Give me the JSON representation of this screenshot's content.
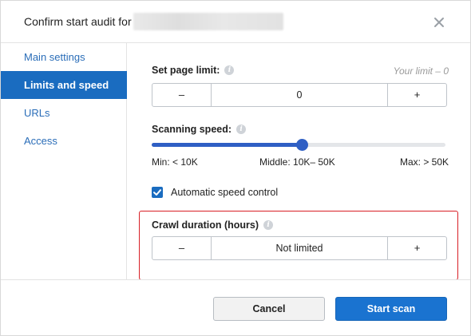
{
  "dialog": {
    "title": "Confirm start audit for",
    "close_icon": "close-icon"
  },
  "sidebar": {
    "items": [
      {
        "label": "Main settings",
        "active": false
      },
      {
        "label": "Limits and speed",
        "active": true
      },
      {
        "label": "URLs",
        "active": false
      },
      {
        "label": "Access",
        "active": false
      }
    ]
  },
  "limits": {
    "page_limit": {
      "label": "Set page limit:",
      "note": "Your limit – 0",
      "decrement": "–",
      "value": "0",
      "increment": "+"
    },
    "scanning_speed": {
      "label": "Scanning speed:",
      "level": 0.51,
      "min_label": "Min: < 10K",
      "middle_label": "Middle: 10K– 50K",
      "max_label": "Max: > 50K"
    },
    "auto_speed": {
      "label": "Automatic speed control",
      "checked": true
    },
    "crawl_duration": {
      "label": "Crawl duration (hours)",
      "decrement": "–",
      "value": "Not limited",
      "increment": "+"
    }
  },
  "footer": {
    "cancel_label": "Cancel",
    "start_label": "Start scan"
  },
  "colors": {
    "accent": "#1a6cc0",
    "slider": "#2f5fc4",
    "highlight": "#d81f26"
  }
}
